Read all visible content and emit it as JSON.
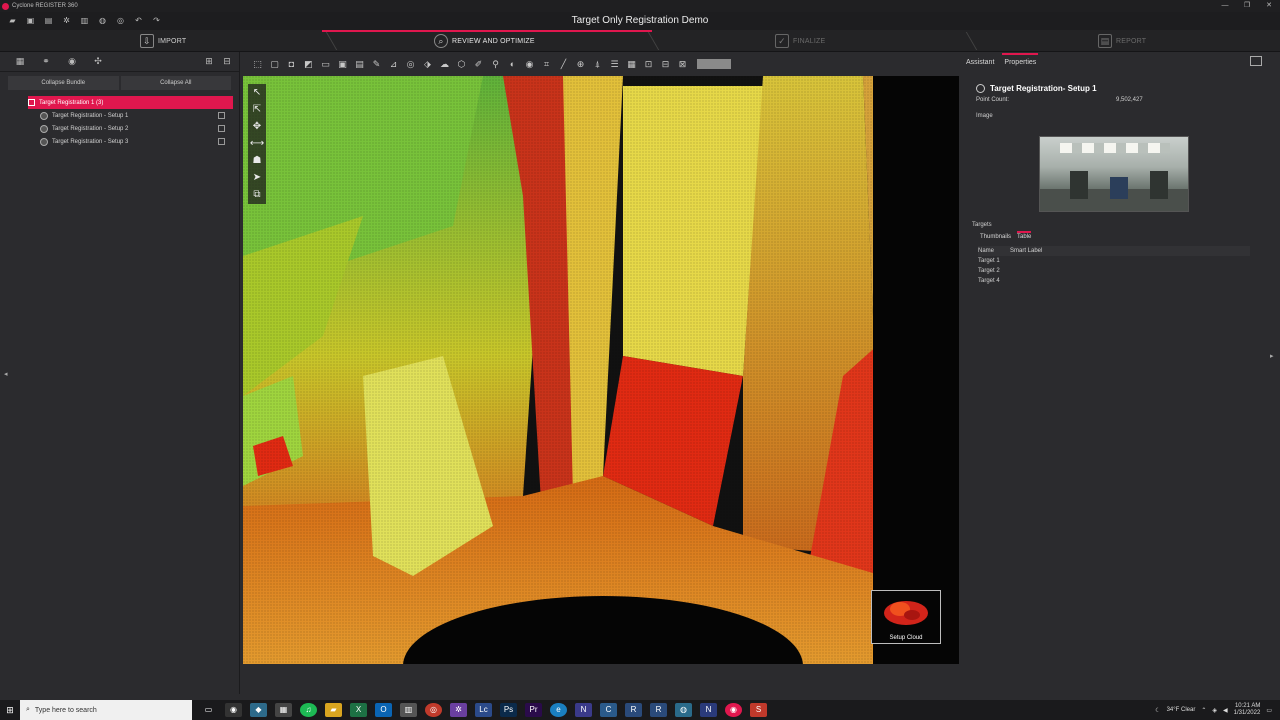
{
  "window": {
    "titlebar_text": "Cyclone REGISTER 360",
    "app_title": "Target Only Registration Demo",
    "min": "—",
    "max": "❐",
    "close": "✕"
  },
  "workflow": {
    "steps": [
      {
        "label": "IMPORT",
        "icon": "⇩"
      },
      {
        "label": "REVIEW AND OPTIMIZE",
        "icon": "⌕"
      },
      {
        "label": "FINALIZE",
        "icon": "✓"
      },
      {
        "label": "REPORT",
        "icon": "▤"
      }
    ]
  },
  "left_panel": {
    "collapse_bundle": "Collapse Bundle",
    "collapse_all": "Collapse All",
    "tree": {
      "bundle": "Target Registration 1 (3)",
      "setups": [
        "Target Registration - Setup 1",
        "Target Registration - Setup 2",
        "Target Registration - Setup 3"
      ]
    }
  },
  "viewport": {
    "setup_cloud_label": "Setup Cloud"
  },
  "right_panel": {
    "tabs": [
      "Assistant",
      "Properties"
    ],
    "title": "Target Registration- Setup 1",
    "point_count_label": "Point Count:",
    "point_count_value": "9,502,427",
    "image_label": "Image",
    "targets_label": "Targets",
    "target_subtabs": [
      "Thumbnails",
      "Table"
    ],
    "table": {
      "columns": [
        "Name",
        "Smart Label"
      ],
      "rows": [
        [
          "Target 1",
          ""
        ],
        [
          "Target 2",
          ""
        ],
        [
          "Target 4",
          ""
        ]
      ]
    }
  },
  "taskbar": {
    "search_placeholder": "Type here to search",
    "weather": "34°F Clear",
    "time": "10:21 AM",
    "date": "1/31/2022"
  },
  "colors": {
    "accent": "#e0174e",
    "panel_bg": "#2b2b2e"
  }
}
